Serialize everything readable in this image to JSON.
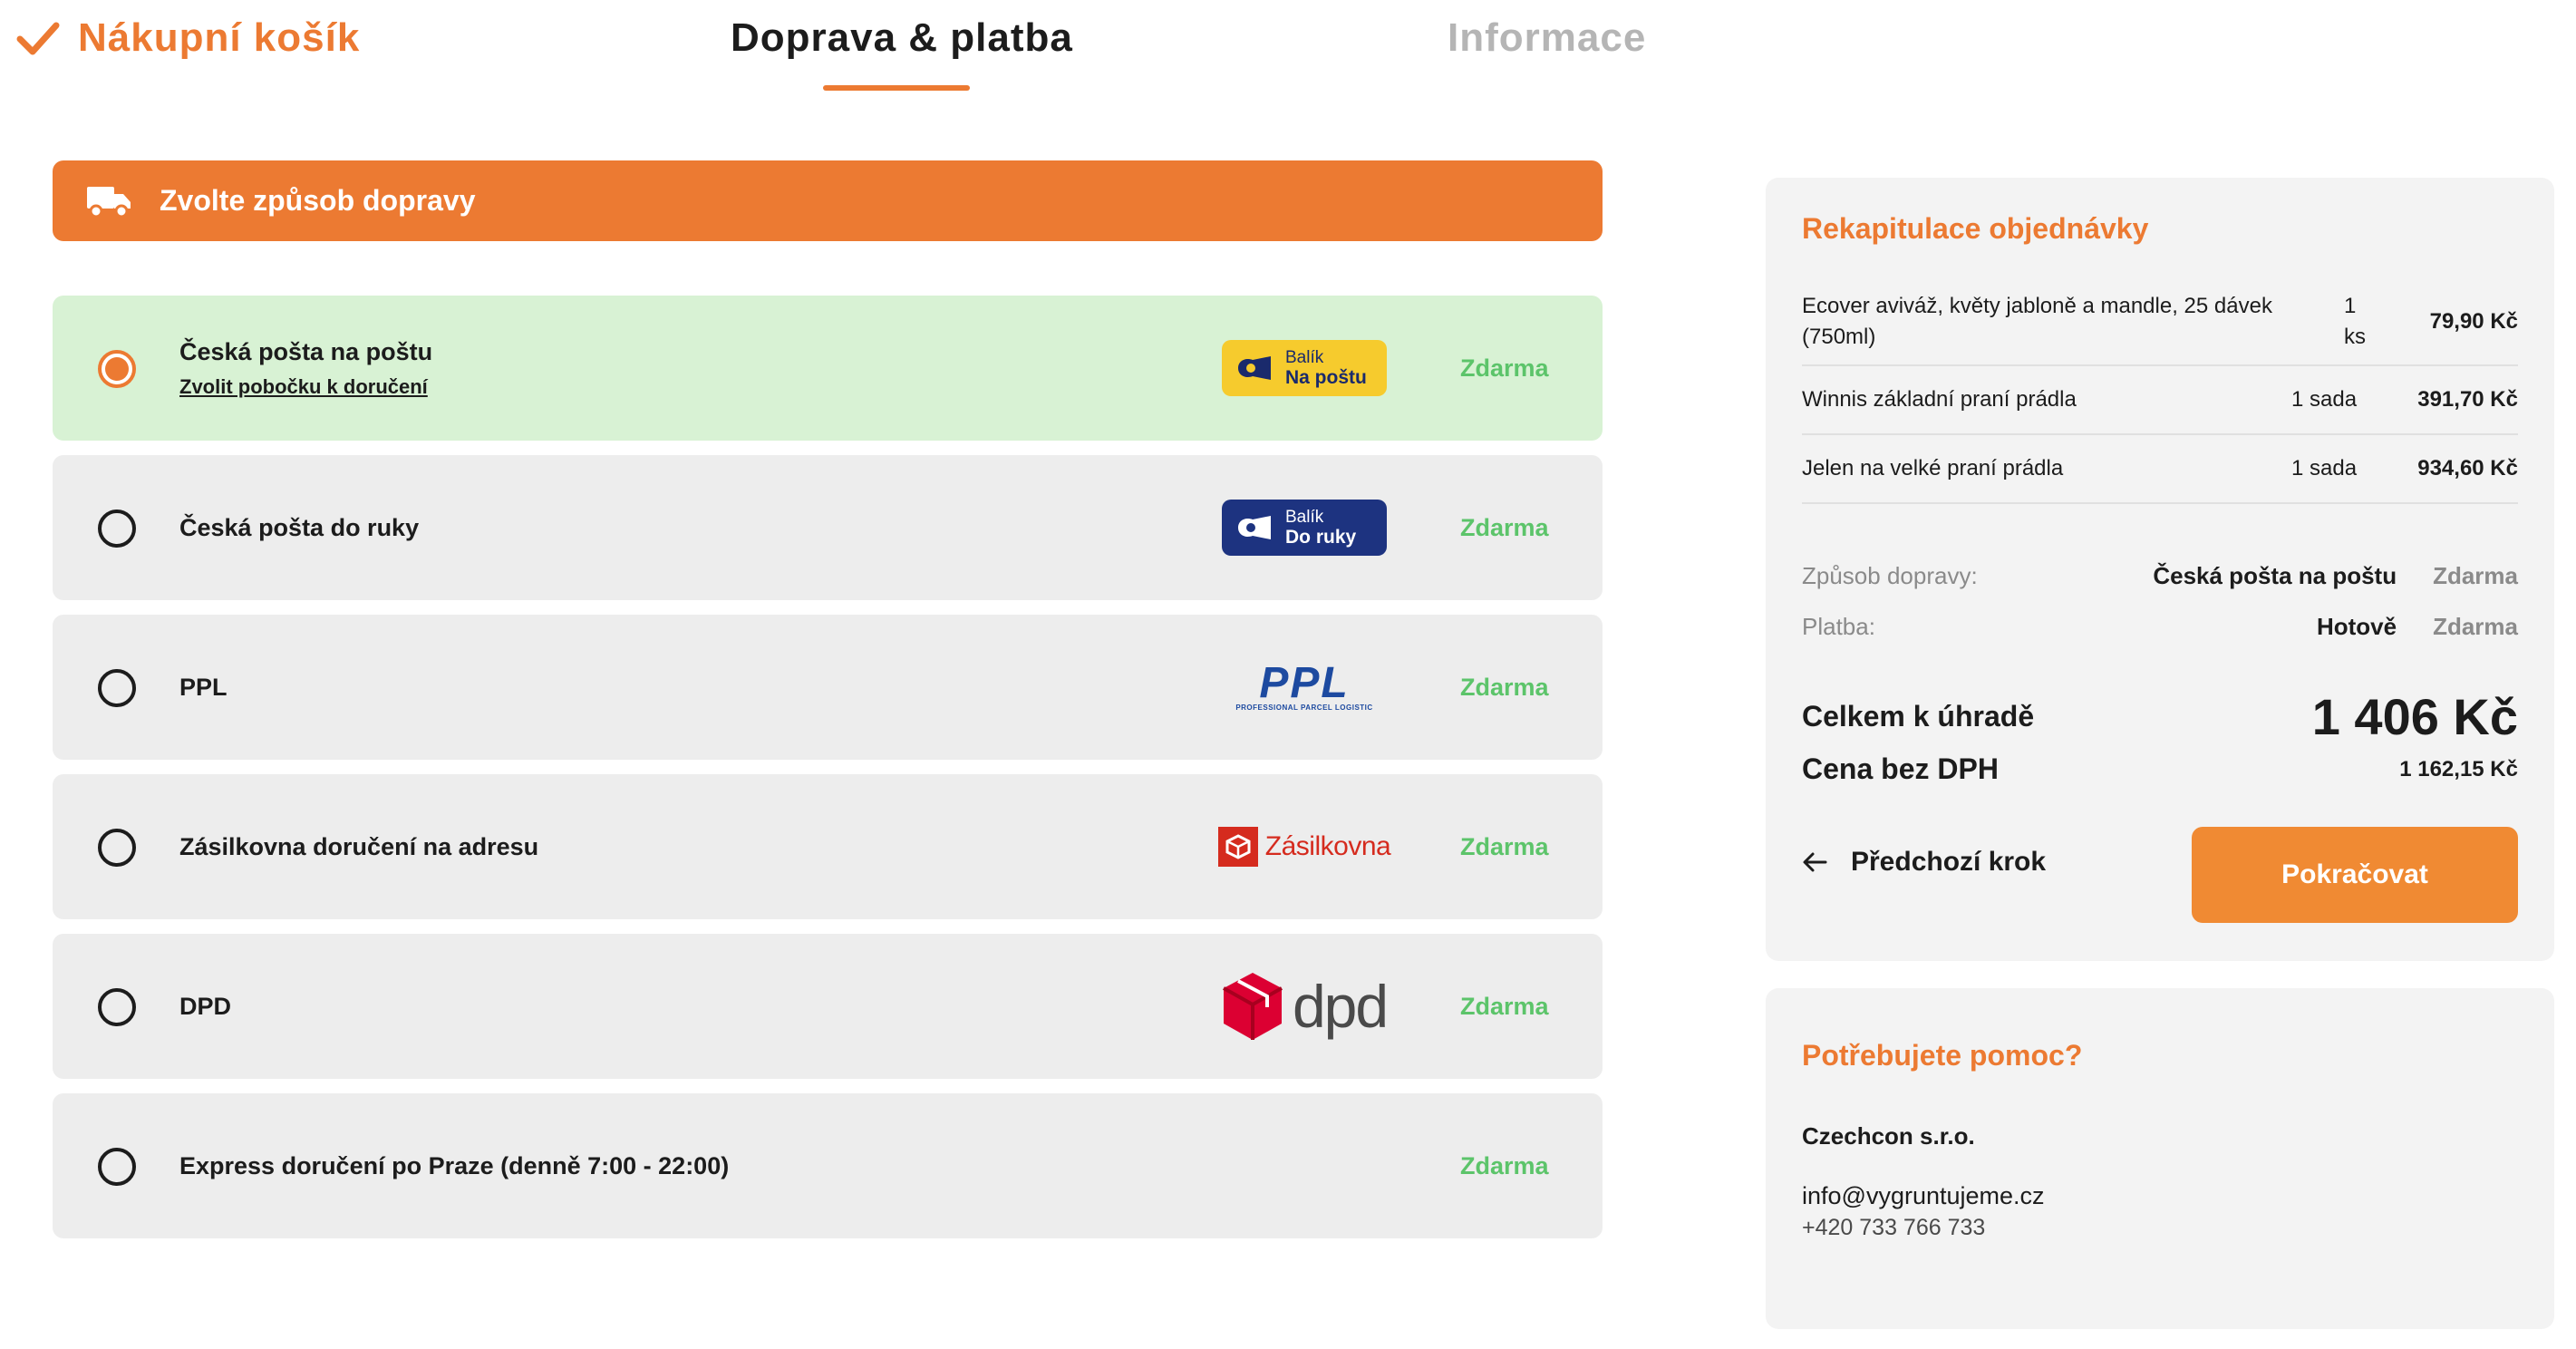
{
  "steps": {
    "cart": "Nákupní košík",
    "shipping": "Doprava & platba",
    "info": "Informace"
  },
  "shipping_header": {
    "label": "Zvolte způsob dopravy",
    "icon": "truck-icon"
  },
  "shipping_options": [
    {
      "name": "Česká pošta na poštu",
      "link": "Zvolit pobočku k doručení",
      "price": "Zdarma",
      "selected": true,
      "logo": {
        "line1": "Balík",
        "line2": "Na poštu"
      }
    },
    {
      "name": "Česká pošta do ruky",
      "price": "Zdarma",
      "selected": false,
      "logo": {
        "line1": "Balík",
        "line2": "Do ruky"
      }
    },
    {
      "name": "PPL",
      "price": "Zdarma",
      "selected": false,
      "logo": {
        "word": "PPL",
        "sub": "PROFESSIONAL PARCEL LOGISTIC"
      }
    },
    {
      "name": "Zásilkovna doručení na adresu",
      "price": "Zdarma",
      "selected": false,
      "logo": {
        "word": "Zásilkovna"
      }
    },
    {
      "name": "DPD",
      "price": "Zdarma",
      "selected": false,
      "logo": {
        "word": "dpd"
      }
    },
    {
      "name": "Express doručení po Praze (denně 7:00 - 22:00)",
      "price": "Zdarma",
      "selected": false
    }
  ],
  "recap": {
    "title": "Rekapitulace objednávky",
    "items": [
      {
        "name": "Ecover aviváž, květy jabloně a mandle, 25 dávek (750ml)",
        "qty": "1 ks",
        "price": "79,90 Kč"
      },
      {
        "name": "Winnis základní praní prádla",
        "qty": "1 sada",
        "price": "391,70 Kč"
      },
      {
        "name": "Jelen na velké praní prádla",
        "qty": "1 sada",
        "price": "934,60 Kč"
      }
    ],
    "shipping_label": "Způsob dopravy:",
    "shipping_value": "Česká pošta na poštu",
    "shipping_price": "Zdarma",
    "payment_label": "Platba:",
    "payment_value": "Hotově",
    "payment_price": "Zdarma",
    "total_label": "Celkem k úhradě",
    "total_value": "1 406 Kč",
    "net_label": "Cena bez DPH",
    "net_value": "1 162,15 Kč",
    "back_label": "Předchozí krok",
    "continue_label": "Pokračovat"
  },
  "help": {
    "title": "Potřebujete pomoc?",
    "company": "Czechcon s.r.o.",
    "email": "info@vygruntujeme.cz",
    "phone": "+420 733 766 733"
  },
  "colors": {
    "accent": "#ec7a32",
    "button": "#f08a33",
    "free": "#5cc46a",
    "selected_bg": "#d8f2d4",
    "option_bg": "#ededed"
  }
}
